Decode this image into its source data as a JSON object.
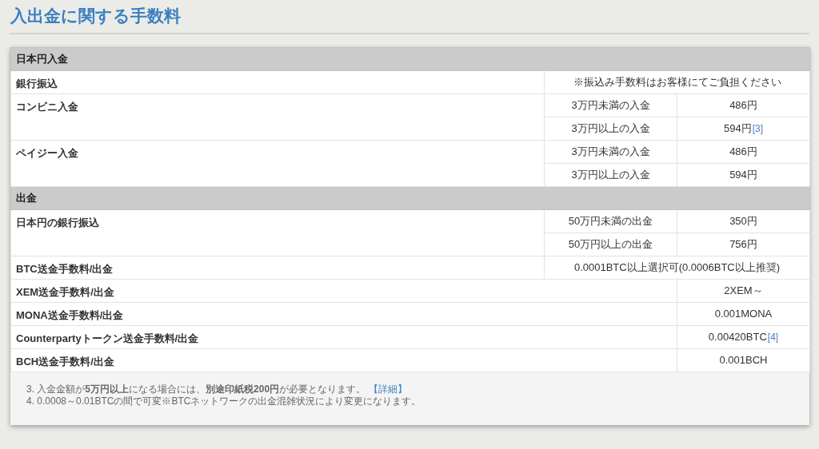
{
  "title": "入出金に関する手数料",
  "sections": [
    {
      "heading": "日本円入金",
      "rows": [
        {
          "kind": "note",
          "label": "銀行振込",
          "text": "※振込み手数料はお客様にてご負担ください"
        },
        {
          "kind": "tiers",
          "label": "コンビニ入金",
          "tiers": [
            {
              "condition": "3万円未満の入金",
              "fee": "486円"
            },
            {
              "condition": "3万円以上の入金",
              "fee": "594円",
              "ref": "[3]"
            }
          ]
        },
        {
          "kind": "tiers",
          "label": "ペイジー入金",
          "tiers": [
            {
              "condition": "3万円未満の入金",
              "fee": "486円"
            },
            {
              "condition": "3万円以上の入金",
              "fee": "594円"
            }
          ]
        }
      ]
    },
    {
      "heading": "出金",
      "rows": [
        {
          "kind": "tiers",
          "label": "日本円の銀行振込",
          "tiers": [
            {
              "condition": "50万円未満の出金",
              "fee": "350円"
            },
            {
              "condition": "50万円以上の出金",
              "fee": "756円"
            }
          ]
        },
        {
          "kind": "note",
          "label": "BTC送金手数料/出金",
          "text": "0.0001BTC以上選択可(0.0006BTC以上推奨)"
        },
        {
          "kind": "fee",
          "label": "XEM送金手数料/出金",
          "fee": "2XEM～"
        },
        {
          "kind": "fee",
          "label": "MONA送金手数料/出金",
          "fee": "0.001MONA"
        },
        {
          "kind": "fee",
          "label": "Counterpartyトークン送金手数料/出金",
          "fee": "0.00420BTC",
          "ref": "[4]"
        },
        {
          "kind": "fee",
          "label": "BCH送金手数料/出金",
          "fee": "0.001BCH"
        }
      ]
    }
  ],
  "footnotes": [
    {
      "text": "3. 入金金額が**5万円以上**になる場合には、**別途印紙税200円**が必要となります。",
      "link": "【詳細】"
    },
    {
      "text": "4. 0.0008～0.01BTCの間で可変※BTCネットワークの出金混雑状況により変更になります。"
    }
  ]
}
